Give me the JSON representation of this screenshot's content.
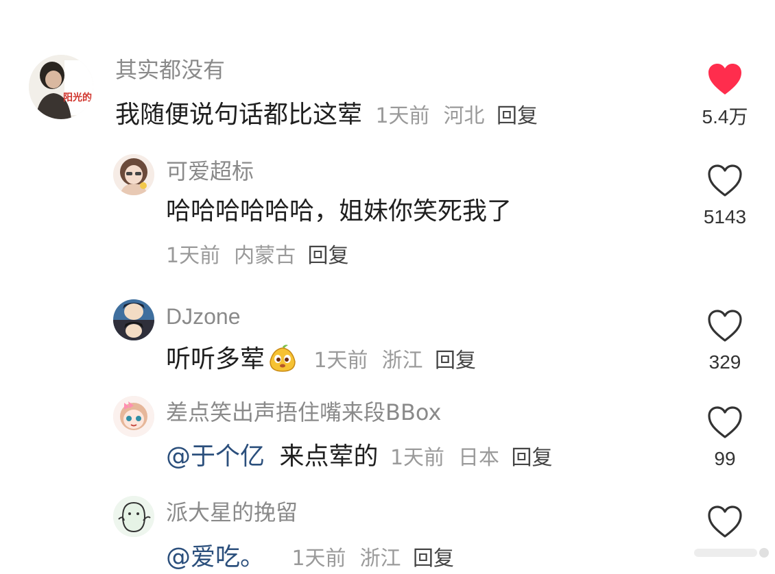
{
  "comments": [
    {
      "user": "其实都没有",
      "text": "我随便说句话都比这荤",
      "time": "1天前",
      "location": "河北",
      "reply": "回复",
      "likes": "5.4万",
      "liked": true,
      "avatar_text": "阳光的"
    },
    {
      "user": "可爱超标",
      "text": "哈哈哈哈哈哈，姐妹你笑死我了",
      "time": "1天前",
      "location": "内蒙古",
      "reply": "回复",
      "likes": "5143",
      "liked": false
    },
    {
      "user": "DJzone",
      "text": "听听多荤",
      "time": "1天前",
      "location": "浙江",
      "reply": "回复",
      "likes": "329",
      "liked": false
    },
    {
      "user": "差点笑出声捂住嘴来段BBox",
      "mention": "@于个亿",
      "text": "来点荤的",
      "time": "1天前",
      "location": "日本",
      "reply": "回复",
      "likes": "99",
      "liked": false
    },
    {
      "user": "派大星的挽留",
      "mention": "@爱吃。",
      "time": "1天前",
      "location": "浙江",
      "reply": "回复",
      "liked": false
    }
  ],
  "colors": {
    "heart_liked": "#ff2d4d",
    "heart_outline": "#333333",
    "mention": "#2b4f7c",
    "meta": "#9a9a9a",
    "username": "#8a8a8a"
  },
  "icons": {
    "like_filled": "heart-filled-icon",
    "like_outline": "heart-outline-icon",
    "emoji": "pear-face-emoji"
  }
}
